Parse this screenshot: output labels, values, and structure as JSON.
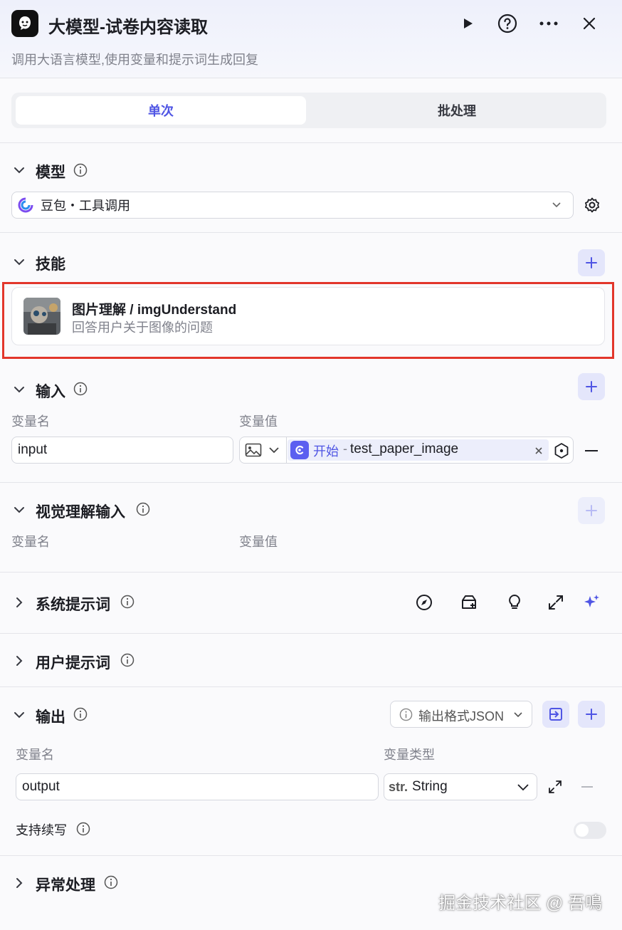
{
  "header": {
    "title": "大模型-试卷内容读取",
    "subtitle": "调用大语言模型,使用变量和提示词生成回复"
  },
  "tabs": [
    {
      "label": "单次",
      "active": true
    },
    {
      "label": "批处理",
      "active": false
    }
  ],
  "model": {
    "section_title": "模型",
    "selected": "豆包・工具调用"
  },
  "skills": {
    "section_title": "技能",
    "items": [
      {
        "name": "图片理解 / imgUnderstand",
        "description": "回答用户关于图像的问题"
      }
    ]
  },
  "inputs": {
    "section_title": "输入",
    "col_name": "变量名",
    "col_value": "变量值",
    "rows": [
      {
        "name": "input",
        "source_node": "开始",
        "separator": "-",
        "source_var": "test_paper_image"
      }
    ]
  },
  "vision_inputs": {
    "section_title": "视觉理解输入",
    "col_name": "变量名",
    "col_value": "变量值"
  },
  "system_prompt": {
    "section_title": "系统提示词"
  },
  "user_prompt": {
    "section_title": "用户提示词"
  },
  "output": {
    "section_title": "输出",
    "format_label": "输出格式JSON",
    "col_name": "变量名",
    "col_type": "变量类型",
    "rows": [
      {
        "name": "output",
        "type_prefix": "str.",
        "type": "String"
      }
    ],
    "continue_label": "支持续写",
    "continue_enabled": false
  },
  "exception": {
    "section_title": "异常处理"
  },
  "watermark": "掘金技术社区 @ 吾鳴",
  "colors": {
    "accent": "#4f55e4",
    "highlight_border": "#e2362b"
  }
}
